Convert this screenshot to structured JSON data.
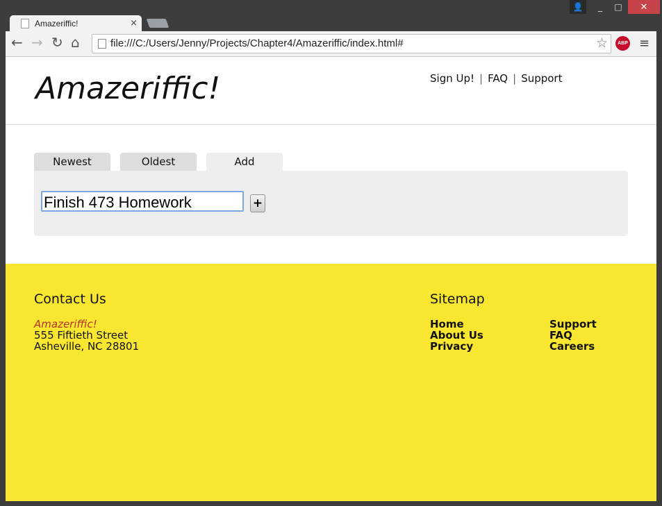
{
  "browser": {
    "tab_title": "Amazeriffic!",
    "tab_close": "×",
    "url": "file:///C:/Users/Jenny/Projects/Chapter4/Amazeriffic/index.html#",
    "abp_label": "ABP",
    "window_buttons": {
      "user": "👤",
      "minimize": "_",
      "maximize": "□",
      "close": "✕"
    },
    "nav": {
      "back": "←",
      "forward": "→",
      "reload": "↻",
      "home": "⌂",
      "star": "☆",
      "menu": "≡"
    }
  },
  "header": {
    "site_title": "Amazeriffic!",
    "nav": [
      "Sign Up!",
      "FAQ",
      "Support"
    ],
    "separator": "|"
  },
  "main": {
    "tabs": [
      {
        "label": "Newest",
        "active": false
      },
      {
        "label": "Oldest",
        "active": false
      },
      {
        "label": "Add",
        "active": true
      }
    ],
    "todo_input_value": "Finish 473 Homework",
    "add_button_label": "+"
  },
  "footer": {
    "contact_heading": "Contact Us",
    "company": "Amazeriffic!",
    "address_line1": "555 Fiftieth Street",
    "address_line2": "Asheville, NC 28801",
    "sitemap_heading": "Sitemap",
    "sitemap_col1": [
      "Home",
      "About Us",
      "Privacy"
    ],
    "sitemap_col2": [
      "Support",
      "FAQ",
      "Careers"
    ]
  },
  "colors": {
    "footer_bg": "#f8e630",
    "company_name": "#b5322b",
    "tab_bg": "#dddddd",
    "panel_bg": "#eeeeee"
  }
}
